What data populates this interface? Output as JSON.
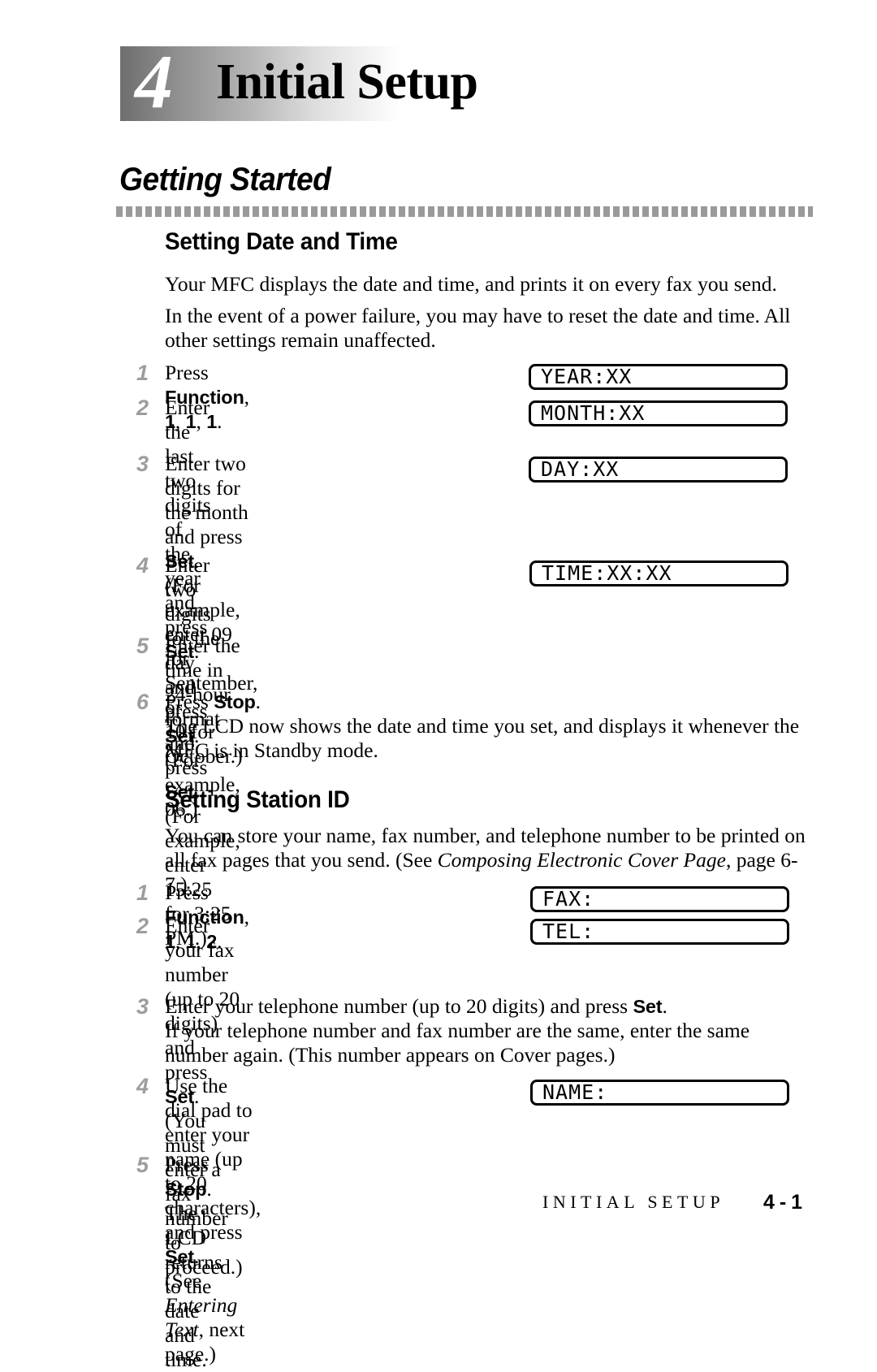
{
  "chapter": {
    "number": "4",
    "title": "Initial Setup"
  },
  "banner": {
    "title": "Getting Started"
  },
  "sections": [
    {
      "heading": "Setting Date and Time",
      "intro": [
        "Your MFC displays the date and time, and prints it on every fax you send.",
        "In the event of a power failure, you may have to reset the date and time. All other settings remain unaffected."
      ]
    },
    {
      "heading": "Setting Station ID",
      "intro": [
        "You can store your name, fax number, and telephone number to be printed on all fax pages that you send. (See Composing Electronic Cover Page, page 6-7.)"
      ],
      "intro_italic_ref": "Composing Electronic Cover Page",
      "intro_page_ref": "6-7"
    }
  ],
  "date_steps": {
    "s1_num": "1",
    "s1_a": "Press ",
    "s1_b": "Function",
    "s1_c": ", ",
    "s1_d": "1",
    "s1_e": ", ",
    "s1_f": "1",
    "s1_g": ", ",
    "s1_h": "1",
    "s1_i": ".",
    "s2_num": "2",
    "s2_a": "Enter the last two digits of the year",
    "s2_b": "and press ",
    "s2_c": "Set",
    "s2_d": ".",
    "s3_num": "3",
    "s3_a": "Enter two digits for the month",
    "s3_b": "and press ",
    "s3_c": "Set",
    "s3_d": ".",
    "s3_e": "(For example, enter 09 for September, or",
    "s3_f": "10 for October.)",
    "s4_num": "4",
    "s4_a": "Enter two digits for the day",
    "s4_b": "and press ",
    "s4_c": "Set",
    "s4_d": ".",
    "s4_e": "(For example, 06.)",
    "s5_num": "5",
    "s5_a": "Enter the time in 24-hour format and press ",
    "s5_b": "Set",
    "s5_c": ".",
    "s5_d": "(For example, enter 15:25 for 3:25 PM.)",
    "s6_num": "6",
    "s6_a": "Press ",
    "s6_b": "Stop",
    "s6_c": ".",
    "s6_d": "The LCD now shows the date and time you set, and displays it whenever the MFC is in Standby mode."
  },
  "station_steps": {
    "s1_num": "1",
    "s1_a": "Press ",
    "s1_b": "Function",
    "s1_c": ", ",
    "s1_d": "1",
    "s1_e": ", ",
    "s1_f": "1",
    "s1_g": ", ",
    "s1_h": "2",
    "s1_i": ".",
    "s2_num": "2",
    "s2_a": "Enter your fax number (up to 20 digits)",
    "s2_b": "and press ",
    "s2_c": "Set",
    "s2_d": ". (You must enter a fax",
    "s2_e": "number to proceed.)",
    "s3_num": "3",
    "s3_a": "Enter your telephone number (up to 20 digits) and press ",
    "s3_b": "Set",
    "s3_c": ".",
    "s3_d": "If your telephone number and fax number are the same, enter the same number again. (This number appears on Cover pages.)",
    "s4_num": "4",
    "s4_a": "Use the dial pad to enter your name (up",
    "s4_b": "to 20 characters), and press ",
    "s4_c": "Set",
    "s4_d": ".",
    "s4_e": "(See ",
    "s4_f": "Entering Text",
    "s4_g": ", next page.)",
    "s5_num": "5",
    "s5_a": "Press ",
    "s5_b": "Stop",
    "s5_c": ". The LCD returns to the date and time."
  },
  "lcd_displays": {
    "year": "YEAR:XX",
    "month": "MONTH:XX",
    "day": "DAY:XX",
    "time": "TIME:XX:XX",
    "fax": "FAX:",
    "tel": "TEL:",
    "name": "NAME:"
  },
  "footer": {
    "title": "INITIAL SETUP",
    "page": "4 - 1"
  }
}
